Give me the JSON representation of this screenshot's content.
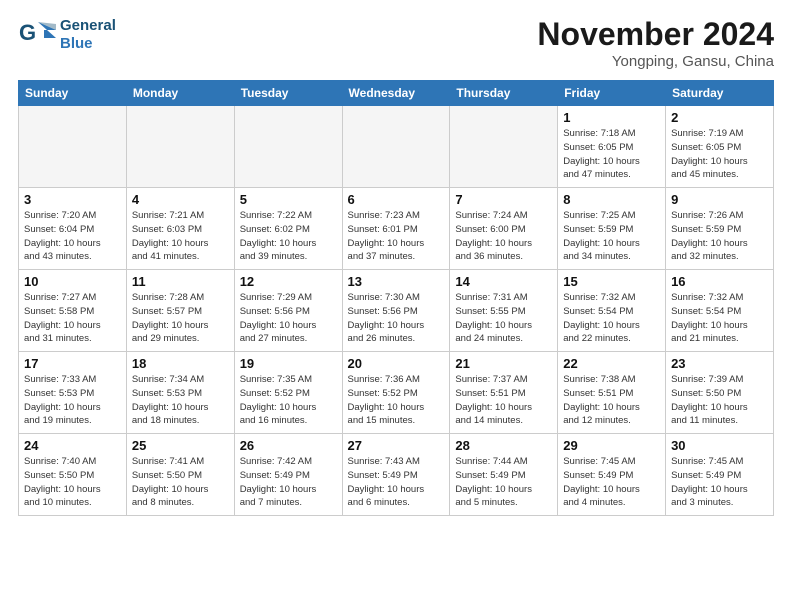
{
  "header": {
    "logo_line1": "General",
    "logo_line2": "Blue",
    "month": "November 2024",
    "location": "Yongping, Gansu, China"
  },
  "weekdays": [
    "Sunday",
    "Monday",
    "Tuesday",
    "Wednesday",
    "Thursday",
    "Friday",
    "Saturday"
  ],
  "weeks": [
    [
      {
        "day": "",
        "info": ""
      },
      {
        "day": "",
        "info": ""
      },
      {
        "day": "",
        "info": ""
      },
      {
        "day": "",
        "info": ""
      },
      {
        "day": "",
        "info": ""
      },
      {
        "day": "1",
        "info": "Sunrise: 7:18 AM\nSunset: 6:05 PM\nDaylight: 10 hours\nand 47 minutes."
      },
      {
        "day": "2",
        "info": "Sunrise: 7:19 AM\nSunset: 6:05 PM\nDaylight: 10 hours\nand 45 minutes."
      }
    ],
    [
      {
        "day": "3",
        "info": "Sunrise: 7:20 AM\nSunset: 6:04 PM\nDaylight: 10 hours\nand 43 minutes."
      },
      {
        "day": "4",
        "info": "Sunrise: 7:21 AM\nSunset: 6:03 PM\nDaylight: 10 hours\nand 41 minutes."
      },
      {
        "day": "5",
        "info": "Sunrise: 7:22 AM\nSunset: 6:02 PM\nDaylight: 10 hours\nand 39 minutes."
      },
      {
        "day": "6",
        "info": "Sunrise: 7:23 AM\nSunset: 6:01 PM\nDaylight: 10 hours\nand 37 minutes."
      },
      {
        "day": "7",
        "info": "Sunrise: 7:24 AM\nSunset: 6:00 PM\nDaylight: 10 hours\nand 36 minutes."
      },
      {
        "day": "8",
        "info": "Sunrise: 7:25 AM\nSunset: 5:59 PM\nDaylight: 10 hours\nand 34 minutes."
      },
      {
        "day": "9",
        "info": "Sunrise: 7:26 AM\nSunset: 5:59 PM\nDaylight: 10 hours\nand 32 minutes."
      }
    ],
    [
      {
        "day": "10",
        "info": "Sunrise: 7:27 AM\nSunset: 5:58 PM\nDaylight: 10 hours\nand 31 minutes."
      },
      {
        "day": "11",
        "info": "Sunrise: 7:28 AM\nSunset: 5:57 PM\nDaylight: 10 hours\nand 29 minutes."
      },
      {
        "day": "12",
        "info": "Sunrise: 7:29 AM\nSunset: 5:56 PM\nDaylight: 10 hours\nand 27 minutes."
      },
      {
        "day": "13",
        "info": "Sunrise: 7:30 AM\nSunset: 5:56 PM\nDaylight: 10 hours\nand 26 minutes."
      },
      {
        "day": "14",
        "info": "Sunrise: 7:31 AM\nSunset: 5:55 PM\nDaylight: 10 hours\nand 24 minutes."
      },
      {
        "day": "15",
        "info": "Sunrise: 7:32 AM\nSunset: 5:54 PM\nDaylight: 10 hours\nand 22 minutes."
      },
      {
        "day": "16",
        "info": "Sunrise: 7:32 AM\nSunset: 5:54 PM\nDaylight: 10 hours\nand 21 minutes."
      }
    ],
    [
      {
        "day": "17",
        "info": "Sunrise: 7:33 AM\nSunset: 5:53 PM\nDaylight: 10 hours\nand 19 minutes."
      },
      {
        "day": "18",
        "info": "Sunrise: 7:34 AM\nSunset: 5:53 PM\nDaylight: 10 hours\nand 18 minutes."
      },
      {
        "day": "19",
        "info": "Sunrise: 7:35 AM\nSunset: 5:52 PM\nDaylight: 10 hours\nand 16 minutes."
      },
      {
        "day": "20",
        "info": "Sunrise: 7:36 AM\nSunset: 5:52 PM\nDaylight: 10 hours\nand 15 minutes."
      },
      {
        "day": "21",
        "info": "Sunrise: 7:37 AM\nSunset: 5:51 PM\nDaylight: 10 hours\nand 14 minutes."
      },
      {
        "day": "22",
        "info": "Sunrise: 7:38 AM\nSunset: 5:51 PM\nDaylight: 10 hours\nand 12 minutes."
      },
      {
        "day": "23",
        "info": "Sunrise: 7:39 AM\nSunset: 5:50 PM\nDaylight: 10 hours\nand 11 minutes."
      }
    ],
    [
      {
        "day": "24",
        "info": "Sunrise: 7:40 AM\nSunset: 5:50 PM\nDaylight: 10 hours\nand 10 minutes."
      },
      {
        "day": "25",
        "info": "Sunrise: 7:41 AM\nSunset: 5:50 PM\nDaylight: 10 hours\nand 8 minutes."
      },
      {
        "day": "26",
        "info": "Sunrise: 7:42 AM\nSunset: 5:49 PM\nDaylight: 10 hours\nand 7 minutes."
      },
      {
        "day": "27",
        "info": "Sunrise: 7:43 AM\nSunset: 5:49 PM\nDaylight: 10 hours\nand 6 minutes."
      },
      {
        "day": "28",
        "info": "Sunrise: 7:44 AM\nSunset: 5:49 PM\nDaylight: 10 hours\nand 5 minutes."
      },
      {
        "day": "29",
        "info": "Sunrise: 7:45 AM\nSunset: 5:49 PM\nDaylight: 10 hours\nand 4 minutes."
      },
      {
        "day": "30",
        "info": "Sunrise: 7:45 AM\nSunset: 5:49 PM\nDaylight: 10 hours\nand 3 minutes."
      }
    ]
  ]
}
